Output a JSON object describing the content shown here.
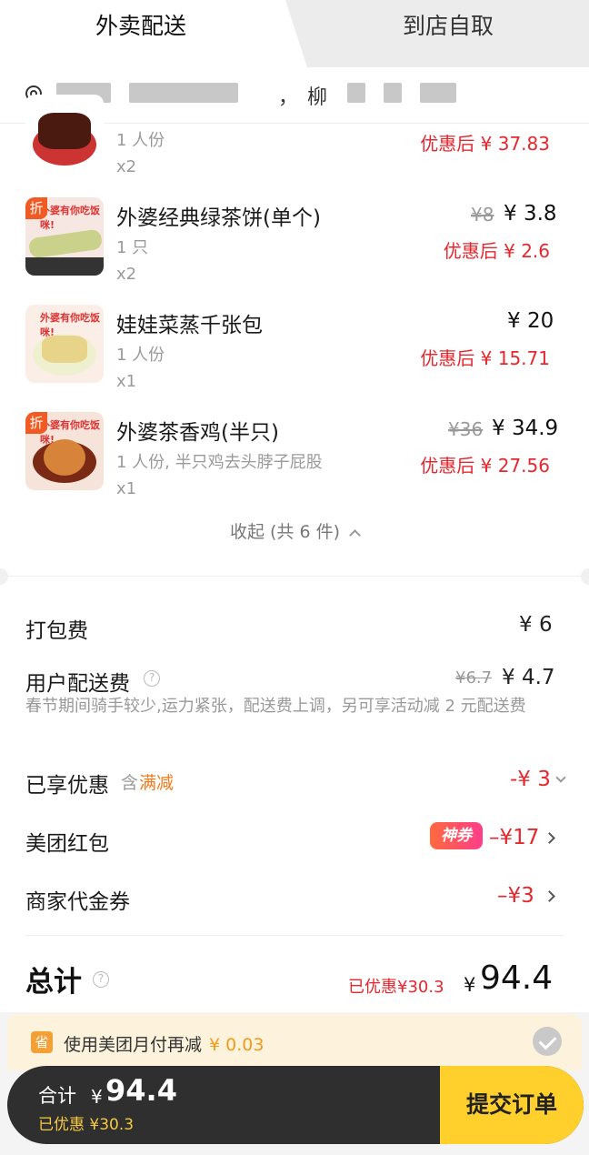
{
  "tabs": {
    "delivery": "外卖配送",
    "pickup": "到店自取"
  },
  "address": {
    "prefix": "，",
    "mid": "，",
    "char": "柳"
  },
  "items": [
    {
      "spec": "1 人份",
      "qty": "x2",
      "discount": "优惠后 ¥ 37.83"
    },
    {
      "name": "外婆经典绿茶饼(单个)",
      "spec": "1 只",
      "qty": "x2",
      "orig": "¥8",
      "price": "¥ 3.8",
      "discount": "优惠后 ¥ 2.6",
      "tag": "折"
    },
    {
      "name": "娃娃菜蒸千张包",
      "spec": "1 人份",
      "qty": "x1",
      "price": "¥ 20",
      "discount": "优惠后 ¥ 15.71"
    },
    {
      "name": "外婆茶香鸡(半只)",
      "spec": "1 人份, 半只鸡去头脖子屁股",
      "qty": "x1",
      "orig": "¥36",
      "price": "¥ 34.9",
      "discount": "优惠后 ¥ 27.56",
      "tag": "折"
    }
  ],
  "thumb_caption": "外婆有你吃饭咪!",
  "collapse": "收起 (共 6 件)",
  "fees": {
    "packing_label": "打包费",
    "packing_value": "¥ 6",
    "delivery_label": "用户配送费",
    "delivery_orig": "¥6.7",
    "delivery_value": "¥ 4.7",
    "delivery_note": "春节期间骑手较少,运力紧张，配送费上调，另可享活动减 2 元配送费",
    "enjoyed_label": "已享优惠",
    "enjoyed_hint_prefix": "含",
    "enjoyed_hint": "满减",
    "enjoyed_value": "-¥ 3",
    "redpack_label": "美团红包",
    "redpack_tag": "神券",
    "redpack_value": "–¥17",
    "voucher_label": "商家代金券",
    "voucher_value": "–¥3"
  },
  "total": {
    "label": "总计",
    "saved": "已优惠¥30.3",
    "yen": "¥",
    "amount": "94.4"
  },
  "monthpay": {
    "icon": "省",
    "text": "使用美团月付再减",
    "amount": "¥ 0.03"
  },
  "bottom": {
    "label": "合计",
    "yen": "¥",
    "amount": "94.4",
    "saved": "已优惠 ¥30.3",
    "submit": "提交订单"
  },
  "colors": {
    "accent_red": "#e8262d",
    "brand_yellow": "#ffd02c",
    "orange": "#f25a24"
  },
  "icons": {
    "location": "location-pin-icon",
    "help": "help-circle-icon",
    "check": "check-circle-icon"
  }
}
